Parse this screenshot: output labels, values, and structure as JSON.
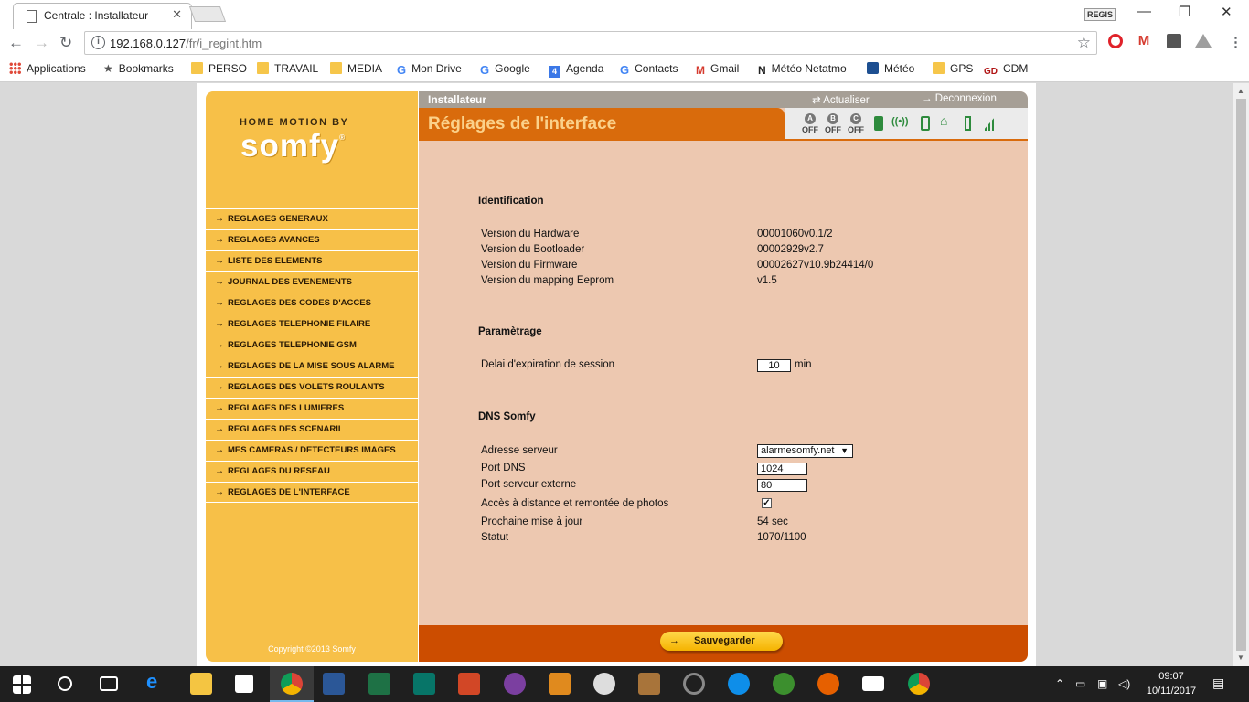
{
  "browser": {
    "tab_title": "Centrale : Installateur",
    "tab_close": "✕",
    "user_badge": "REGIS",
    "url_host": "192.168.0.127",
    "url_path": "/fr/i_regint.htm",
    "bookmarks": [
      {
        "label": "Applications",
        "icon": "apps-grid-icon"
      },
      {
        "label": "Bookmarks",
        "icon": "star-icon"
      },
      {
        "label": "PERSO",
        "icon": "folder-icon"
      },
      {
        "label": "TRAVAIL",
        "icon": "folder-icon"
      },
      {
        "label": "MEDIA",
        "icon": "folder-icon"
      },
      {
        "label": "Mon Drive",
        "icon": "google-icon"
      },
      {
        "label": "Google",
        "icon": "google-icon"
      },
      {
        "label": "Agenda",
        "icon": "calendar-icon"
      },
      {
        "label": "Contacts",
        "icon": "google-icon"
      },
      {
        "label": "Gmail",
        "icon": "gmail-icon"
      },
      {
        "label": "Météo Netatmo",
        "icon": "netatmo-icon"
      },
      {
        "label": "Météo",
        "icon": "meteo-icon"
      },
      {
        "label": "GPS",
        "icon": "folder-icon"
      },
      {
        "label": "CDM",
        "icon": "cdm-icon"
      }
    ]
  },
  "sidebar": {
    "logo_top": "HOME MOTION BY",
    "logo_brand": "somfy",
    "logo_reg": "®",
    "menu": [
      "REGLAGES GENERAUX",
      "REGLAGES AVANCES",
      "LISTE DES ELEMENTS",
      "JOURNAL DES EVENEMENTS",
      "REGLAGES DES CODES D'ACCES",
      "REGLAGES TELEPHONIE FILAIRE",
      "REGLAGES TELEPHONIE GSM",
      "REGLAGES DE LA MISE SOUS ALARME",
      "REGLAGES DES VOLETS ROULANTS",
      "REGLAGES DES LUMIERES",
      "REGLAGES DES SCENARII",
      "MES CAMERAS / DETECTEURS IMAGES",
      "REGLAGES DU RESEAU",
      "REGLAGES DE L'INTERFACE"
    ],
    "copyright": "Copyright ©2013 Somfy"
  },
  "header": {
    "breadcrumb": "Installateur",
    "refresh_label": "Actualiser",
    "logout_label": "Deconnexion",
    "page_title": "Réglages de l'interface",
    "zones": [
      {
        "letter": "A",
        "state": "OFF"
      },
      {
        "letter": "B",
        "state": "OFF"
      },
      {
        "letter": "C",
        "state": "OFF"
      }
    ]
  },
  "identification": {
    "title": "Identification",
    "rows": [
      {
        "label": "Version du Hardware",
        "value": "00001060v0.1/2"
      },
      {
        "label": "Version du Bootloader",
        "value": "00002929v2.7"
      },
      {
        "label": "Version du Firmware",
        "value": "00002627v10.9b24414/0"
      },
      {
        "label": "Version du mapping Eeprom",
        "value": "v1.5"
      }
    ]
  },
  "parametrage": {
    "title": "Paramètrage",
    "session_label": "Delai d'expiration de session",
    "session_value": "10",
    "session_unit": "min"
  },
  "dns": {
    "title": "DNS Somfy",
    "server_label": "Adresse serveur",
    "server_value": "alarmesomfy.net",
    "port_dns_label": "Port DNS",
    "port_dns_value": "1024",
    "port_ext_label": "Port serveur externe",
    "port_ext_value": "80",
    "remote_label": "Accès à distance et remontée de photos",
    "remote_checked": true,
    "next_update_label": "Prochaine mise à jour",
    "next_update_value": "54 sec",
    "status_label": "Statut",
    "status_value": "1070/1100"
  },
  "footer": {
    "save_label": "Sauvegarder"
  },
  "taskbar": {
    "time": "09:07",
    "date": "10/11/2017"
  }
}
